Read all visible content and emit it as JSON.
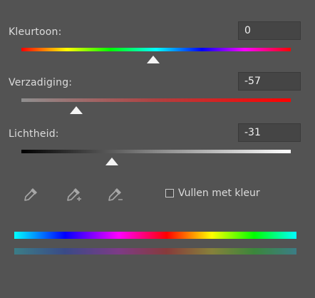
{
  "hue": {
    "label": "Kleurtoon:",
    "value": "0",
    "slider_position": 0.5
  },
  "saturation": {
    "label": "Verzadiging:",
    "value": "-57",
    "slider_position": 0.21
  },
  "lightness": {
    "label": "Lichtheid:",
    "value": "-31",
    "slider_position": 0.34
  },
  "tools": {
    "eyedropper_icon": "eyedropper-icon",
    "eyedropper_plus_icon": "eyedropper-plus-icon",
    "eyedropper_minus_icon": "eyedropper-minus-icon"
  },
  "colorize": {
    "label": "Vullen met kleur",
    "checked": false
  }
}
